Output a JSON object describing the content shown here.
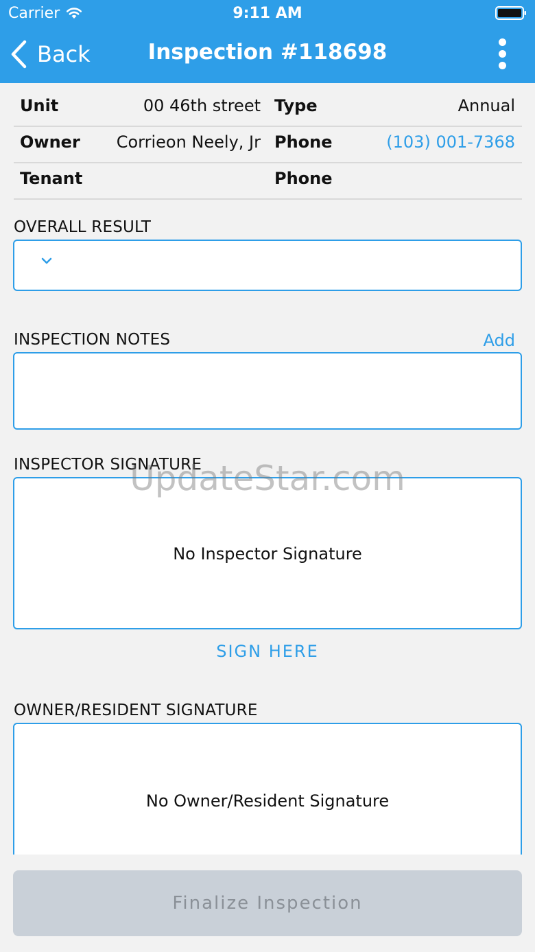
{
  "status_bar": {
    "carrier": "Carrier",
    "time": "9:11 AM"
  },
  "nav": {
    "back_label": "Back",
    "title": "Inspection #118698"
  },
  "info": {
    "unit_label": "Unit",
    "unit_value": "00 46th street",
    "type_label": "Type",
    "type_value": "Annual",
    "owner_label": "Owner",
    "owner_value": "Corrieon Neely, Jr",
    "owner_phone_label": "Phone",
    "owner_phone_value": "(103) 001-7368",
    "tenant_label": "Tenant",
    "tenant_value": "",
    "tenant_phone_label": "Phone",
    "tenant_phone_value": ""
  },
  "overall_result": {
    "label": "OVERALL RESULT",
    "selected": ""
  },
  "notes": {
    "label": "INSPECTION NOTES",
    "add_label": "Add",
    "value": ""
  },
  "inspector_signature": {
    "label": "INSPECTOR SIGNATURE",
    "empty_text": "No Inspector Signature",
    "sign_label": "SIGN HERE"
  },
  "owner_signature": {
    "label": "OWNER/RESIDENT SIGNATURE",
    "empty_text": "No Owner/Resident Signature"
  },
  "finalize": {
    "label": "Finalize Inspection"
  },
  "watermark": "UpdateStar.com",
  "colors": {
    "accent": "#2e9ee8",
    "background": "#f2f2f2",
    "disabled_button": "#c9d0d8"
  }
}
